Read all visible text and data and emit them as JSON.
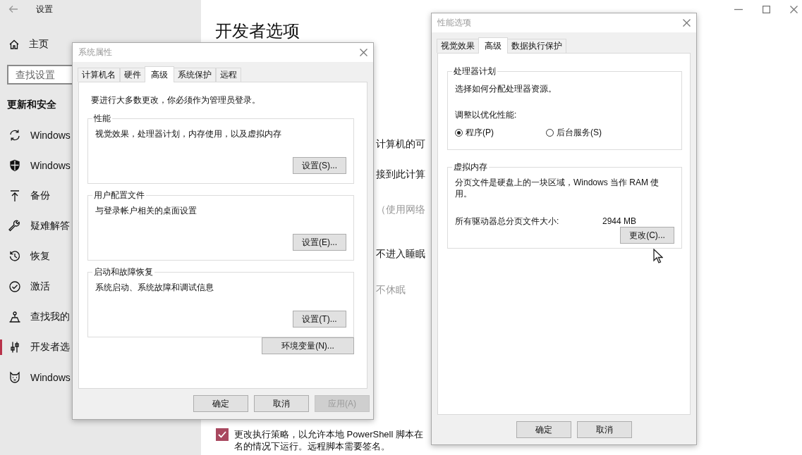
{
  "settings": {
    "title": "设置",
    "sidebar": {
      "home": "主页",
      "search": {
        "placeholder": "查找设置"
      },
      "section": "更新和安全",
      "items": [
        {
          "label": "Windows",
          "selected": false
        },
        {
          "label": "Windows",
          "selected": false
        },
        {
          "label": "备份",
          "selected": false
        },
        {
          "label": "疑难解答",
          "selected": false
        },
        {
          "label": "恢复",
          "selected": false
        },
        {
          "label": "激活",
          "selected": false
        },
        {
          "label": "查找我的",
          "selected": false
        },
        {
          "label": "开发者选",
          "selected": true
        },
        {
          "label": "Windows",
          "selected": false
        }
      ]
    },
    "page": {
      "heading": "开发者选项",
      "lines": [
        {
          "text": "计算机的可",
          "disabled": false
        },
        {
          "text": "接到此计算",
          "disabled": false
        },
        {
          "text": "（使用网络",
          "disabled": true
        },
        {
          "text": "不进入睡眠",
          "disabled": false
        },
        {
          "text": "不休眠",
          "disabled": true
        }
      ],
      "checkbox": {
        "checked": true,
        "lines": [
          "更改执行策略，以允许本地 PowerShell 脚本在",
          "名的情况下运行。远程脚本需要签名。"
        ]
      }
    }
  },
  "system_properties": {
    "title": "系统属性",
    "tabs": [
      {
        "label": "计算机名",
        "selected": false
      },
      {
        "label": "硬件",
        "selected": false
      },
      {
        "label": "高级",
        "selected": true
      },
      {
        "label": "系统保护",
        "selected": false
      },
      {
        "label": "远程",
        "selected": false
      }
    ],
    "intro": "要进行大多数更改，你必须作为管理员登录。",
    "groups": [
      {
        "title": "性能",
        "text": "视觉效果，处理器计划，内存使用，以及虚拟内存",
        "button": "设置(S)..."
      },
      {
        "title": "用户配置文件",
        "text": "与登录帐户相关的桌面设置",
        "button": "设置(E)..."
      },
      {
        "title": "启动和故障恢复",
        "text": "系统启动、系统故障和调试信息",
        "button": "设置(T)..."
      }
    ],
    "env_button": "环境变量(N)...",
    "buttons": [
      {
        "label": "确定",
        "disabled": false
      },
      {
        "label": "取消",
        "disabled": false
      },
      {
        "label": "应用(A)",
        "disabled": true
      }
    ]
  },
  "performance_options": {
    "title": "性能选项",
    "tabs": [
      {
        "label": "视觉效果",
        "selected": false
      },
      {
        "label": "高级",
        "selected": true
      },
      {
        "label": "数据执行保护",
        "selected": false
      }
    ],
    "groups": [
      {
        "kind": "radio",
        "title": "处理器计划",
        "text": "选择如何分配处理器资源。",
        "prompt": "调整以优化性能:",
        "options": [
          {
            "label": "程序(P)",
            "selected": true
          },
          {
            "label": "后台服务(S)",
            "selected": false
          }
        ]
      },
      {
        "kind": "pagefile",
        "title": "虚拟内存",
        "text": "分页文件是硬盘上的一块区域，Windows 当作 RAM 使用。",
        "size_label": "所有驱动器总分页文件大小:",
        "size": "2944 MB",
        "button": "更改(C)..."
      }
    ],
    "buttons": [
      {
        "label": "确定",
        "disabled": false
      },
      {
        "label": "取消",
        "disabled": false
      }
    ]
  }
}
